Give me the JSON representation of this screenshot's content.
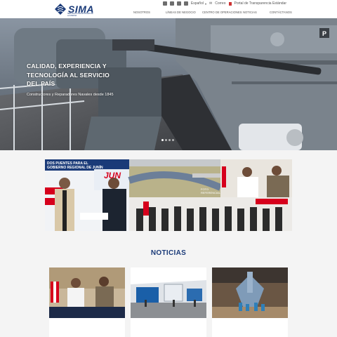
{
  "header": {
    "logo_text": "SIMA",
    "logo_sub": "SERVICIOS INDUSTRIALES DE LA MARINA",
    "lang": "Español",
    "search": "Correo",
    "portal": "Portal de Transparencia Estándar",
    "nav": [
      "NOSOTROS",
      "LÍNEAS DE NEGOCIO",
      "CENTRO DE OPERACIONES",
      "NOTICIAS",
      "CONTÁCTANOS"
    ]
  },
  "hero": {
    "title_lines": [
      "CALIDAD, EXPERIENCIA Y",
      "TECNOLOGÍA AL SERVICIO",
      "DEL PAÍS"
    ],
    "subtitle": "Constructores y Reparadores Navales desde 1845",
    "slides": 4,
    "active_slide": 1
  },
  "banner": {
    "headline_1": "DOS PUENTES PARA EL",
    "headline_2": "GOBIERNO REGIONAL DE JUNÍN",
    "logo_word": "JUN",
    "photo_note": "FOTO REFERENCIAL"
  },
  "noticias": {
    "title": "NOTICIAS"
  },
  "colors": {
    "brand": "#1a3a78",
    "accent_red": "#d6001c"
  }
}
